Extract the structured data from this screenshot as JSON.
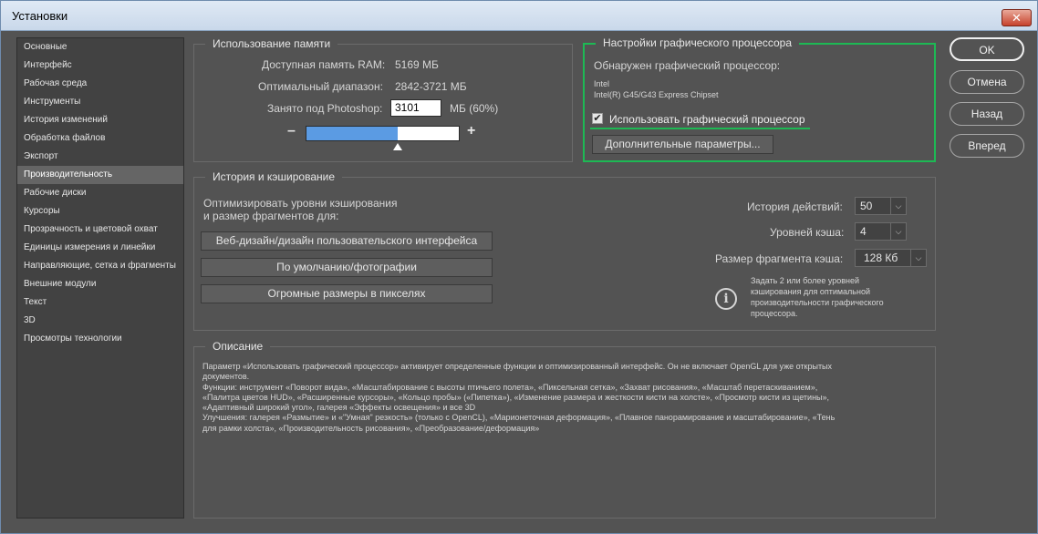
{
  "window": {
    "title": "Установки",
    "close_label": "✕"
  },
  "sidebar": {
    "items": [
      {
        "label": "Основные"
      },
      {
        "label": "Интерфейс"
      },
      {
        "label": "Рабочая среда"
      },
      {
        "label": "Инструменты"
      },
      {
        "label": "История изменений"
      },
      {
        "label": "Обработка файлов"
      },
      {
        "label": "Экспорт"
      },
      {
        "label": "Производительность",
        "active": true
      },
      {
        "label": "Рабочие диски"
      },
      {
        "label": "Курсоры"
      },
      {
        "label": "Прозрачность и цветовой охват"
      },
      {
        "label": "Единицы измерения и линейки"
      },
      {
        "label": "Направляющие, сетка и фрагменты"
      },
      {
        "label": "Внешние модули"
      },
      {
        "label": "Текст"
      },
      {
        "label": "3D"
      },
      {
        "label": "Просмотры технологии"
      }
    ]
  },
  "memory": {
    "legend": "Использование памяти",
    "available_label": "Доступная память RAM:",
    "available_value": "5169 МБ",
    "optimal_label": "Оптимальный диапазон:",
    "optimal_value": "2842-3721 МБ",
    "used_label": "Занято под Photoshop:",
    "used_value": "3101",
    "used_unit": "МБ (60%)",
    "slider_fraction": 0.6,
    "minus": "–",
    "plus": "+"
  },
  "gpu": {
    "legend": "Настройки графического процессора",
    "detected_label": "Обнаружен графический процессор:",
    "vendor": "Intel",
    "model": "Intel(R) G45/G43 Express Chipset",
    "use_gpu_label": "Использовать графический процессор",
    "use_gpu_checked": "✔",
    "advanced_button": "Дополнительные параметры..."
  },
  "history": {
    "legend": "История и кэширование",
    "optimize_line1": "Оптимизировать уровни кэширования",
    "optimize_line2": "и размер фрагментов для:",
    "btn_web": "Веб-дизайн/дизайн пользовательского интерфейса",
    "btn_default": "По умолчанию/фотографии",
    "btn_huge": "Огромные размеры в пикселях",
    "history_states_label": "История действий:",
    "history_states_value": "50",
    "cache_levels_label": "Уровней кэша:",
    "cache_levels_value": "4",
    "tile_size_label": "Размер фрагмента кэша:",
    "tile_size_value": "128 Кб",
    "info_line1": "Задать 2 или более уровней",
    "info_line2": "кэширования для оптимальной",
    "info_line3": "производительности графического",
    "info_line4": "процессора.",
    "info_icon": "i"
  },
  "description": {
    "legend": "Описание",
    "text": "Параметр «Использовать графический процессор» активирует определенные функции и оптимизированный интерфейс. Он не включает OpenGL для уже открытых\nдокументов.\nФункции: инструмент «Поворот вида», «Масштабирование с высоты птичьего полета», «Пиксельная сетка», «Захват рисования», «Масштаб перетаскиванием»,\n«Палитра цветов HUD», «Расширенные курсоры», «Кольцо пробы» («Пипетка»), «Изменение размера и жесткости кисти на холсте», «Просмотр кисти из щетины»,\n«Адаптивный широкий угол», галерея «Эффекты освещения» и все 3D\nУлучшения: галерея «Размытие» и «\"Умная\" резкость» (только с OpenCL), «Марионеточная деформация», «Плавное панорамирование и масштабирование», «Тень\nдля рамки холста», «Производительность рисования», «Преобразование/деформация»"
  },
  "actions": {
    "ok": "OK",
    "cancel": "Отмена",
    "back": "Назад",
    "forward": "Вперед"
  },
  "colors": {
    "accent_green": "#1db954",
    "slider_fill": "#5b9be3",
    "panel_bg": "#535353"
  }
}
